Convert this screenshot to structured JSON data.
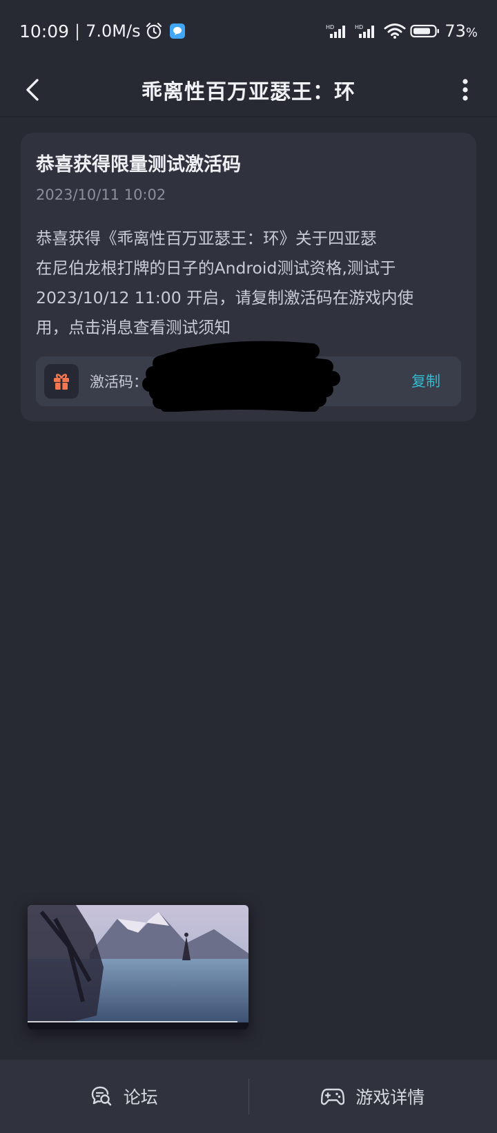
{
  "status_bar": {
    "time": "10:09",
    "separator": "|",
    "net_speed": "7.0M/s",
    "battery": "73",
    "battery_unit": "%",
    "icons": [
      "alarm-icon",
      "message-app-icon",
      "hd-signal-icon",
      "hd-signal-icon",
      "wifi-icon",
      "battery-icon"
    ]
  },
  "header": {
    "title": "乖离性百万亚瑟王：环",
    "back_icon": "back-chevron-icon",
    "more_icon": "more-vertical-icon"
  },
  "message": {
    "title": "恭喜获得限量测试激活码",
    "date": "2023/10/11 10:02",
    "body_lines": [
      "恭喜获得《乖离性百万亚瑟王：环》关于四亚瑟",
      "在尼伯龙根打牌的日子的Android测试资格,测试于",
      "2023/10/12 11:00 开启，请复制激活码在游戏内使",
      "用，点击消息查看测试须知"
    ],
    "code_label": "激活码：",
    "code_icon": "gift-icon",
    "copy_label": "复制"
  },
  "video": {
    "progress": 0.95
  },
  "bottom_nav": {
    "forum_label": "论坛",
    "forum_icon": "chat-search-icon",
    "details_label": "游戏详情",
    "details_icon": "gamepad-icon"
  },
  "colors": {
    "background": "#272933",
    "card": "#30323e",
    "accent": "#33bcd0",
    "gift": "#f4774f"
  }
}
